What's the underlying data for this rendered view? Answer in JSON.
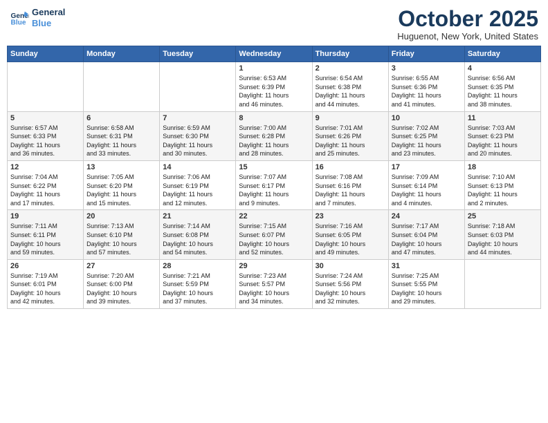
{
  "logo": {
    "line1": "General",
    "line2": "Blue"
  },
  "title": "October 2025",
  "subtitle": "Huguenot, New York, United States",
  "days_of_week": [
    "Sunday",
    "Monday",
    "Tuesday",
    "Wednesday",
    "Thursday",
    "Friday",
    "Saturday"
  ],
  "weeks": [
    [
      {
        "day": "",
        "info": ""
      },
      {
        "day": "",
        "info": ""
      },
      {
        "day": "",
        "info": ""
      },
      {
        "day": "1",
        "info": "Sunrise: 6:53 AM\nSunset: 6:39 PM\nDaylight: 11 hours\nand 46 minutes."
      },
      {
        "day": "2",
        "info": "Sunrise: 6:54 AM\nSunset: 6:38 PM\nDaylight: 11 hours\nand 44 minutes."
      },
      {
        "day": "3",
        "info": "Sunrise: 6:55 AM\nSunset: 6:36 PM\nDaylight: 11 hours\nand 41 minutes."
      },
      {
        "day": "4",
        "info": "Sunrise: 6:56 AM\nSunset: 6:35 PM\nDaylight: 11 hours\nand 38 minutes."
      }
    ],
    [
      {
        "day": "5",
        "info": "Sunrise: 6:57 AM\nSunset: 6:33 PM\nDaylight: 11 hours\nand 36 minutes."
      },
      {
        "day": "6",
        "info": "Sunrise: 6:58 AM\nSunset: 6:31 PM\nDaylight: 11 hours\nand 33 minutes."
      },
      {
        "day": "7",
        "info": "Sunrise: 6:59 AM\nSunset: 6:30 PM\nDaylight: 11 hours\nand 30 minutes."
      },
      {
        "day": "8",
        "info": "Sunrise: 7:00 AM\nSunset: 6:28 PM\nDaylight: 11 hours\nand 28 minutes."
      },
      {
        "day": "9",
        "info": "Sunrise: 7:01 AM\nSunset: 6:26 PM\nDaylight: 11 hours\nand 25 minutes."
      },
      {
        "day": "10",
        "info": "Sunrise: 7:02 AM\nSunset: 6:25 PM\nDaylight: 11 hours\nand 23 minutes."
      },
      {
        "day": "11",
        "info": "Sunrise: 7:03 AM\nSunset: 6:23 PM\nDaylight: 11 hours\nand 20 minutes."
      }
    ],
    [
      {
        "day": "12",
        "info": "Sunrise: 7:04 AM\nSunset: 6:22 PM\nDaylight: 11 hours\nand 17 minutes."
      },
      {
        "day": "13",
        "info": "Sunrise: 7:05 AM\nSunset: 6:20 PM\nDaylight: 11 hours\nand 15 minutes."
      },
      {
        "day": "14",
        "info": "Sunrise: 7:06 AM\nSunset: 6:19 PM\nDaylight: 11 hours\nand 12 minutes."
      },
      {
        "day": "15",
        "info": "Sunrise: 7:07 AM\nSunset: 6:17 PM\nDaylight: 11 hours\nand 9 minutes."
      },
      {
        "day": "16",
        "info": "Sunrise: 7:08 AM\nSunset: 6:16 PM\nDaylight: 11 hours\nand 7 minutes."
      },
      {
        "day": "17",
        "info": "Sunrise: 7:09 AM\nSunset: 6:14 PM\nDaylight: 11 hours\nand 4 minutes."
      },
      {
        "day": "18",
        "info": "Sunrise: 7:10 AM\nSunset: 6:13 PM\nDaylight: 11 hours\nand 2 minutes."
      }
    ],
    [
      {
        "day": "19",
        "info": "Sunrise: 7:11 AM\nSunset: 6:11 PM\nDaylight: 10 hours\nand 59 minutes."
      },
      {
        "day": "20",
        "info": "Sunrise: 7:13 AM\nSunset: 6:10 PM\nDaylight: 10 hours\nand 57 minutes."
      },
      {
        "day": "21",
        "info": "Sunrise: 7:14 AM\nSunset: 6:08 PM\nDaylight: 10 hours\nand 54 minutes."
      },
      {
        "day": "22",
        "info": "Sunrise: 7:15 AM\nSunset: 6:07 PM\nDaylight: 10 hours\nand 52 minutes."
      },
      {
        "day": "23",
        "info": "Sunrise: 7:16 AM\nSunset: 6:05 PM\nDaylight: 10 hours\nand 49 minutes."
      },
      {
        "day": "24",
        "info": "Sunrise: 7:17 AM\nSunset: 6:04 PM\nDaylight: 10 hours\nand 47 minutes."
      },
      {
        "day": "25",
        "info": "Sunrise: 7:18 AM\nSunset: 6:03 PM\nDaylight: 10 hours\nand 44 minutes."
      }
    ],
    [
      {
        "day": "26",
        "info": "Sunrise: 7:19 AM\nSunset: 6:01 PM\nDaylight: 10 hours\nand 42 minutes."
      },
      {
        "day": "27",
        "info": "Sunrise: 7:20 AM\nSunset: 6:00 PM\nDaylight: 10 hours\nand 39 minutes."
      },
      {
        "day": "28",
        "info": "Sunrise: 7:21 AM\nSunset: 5:59 PM\nDaylight: 10 hours\nand 37 minutes."
      },
      {
        "day": "29",
        "info": "Sunrise: 7:23 AM\nSunset: 5:57 PM\nDaylight: 10 hours\nand 34 minutes."
      },
      {
        "day": "30",
        "info": "Sunrise: 7:24 AM\nSunset: 5:56 PM\nDaylight: 10 hours\nand 32 minutes."
      },
      {
        "day": "31",
        "info": "Sunrise: 7:25 AM\nSunset: 5:55 PM\nDaylight: 10 hours\nand 29 minutes."
      },
      {
        "day": "",
        "info": ""
      }
    ]
  ]
}
